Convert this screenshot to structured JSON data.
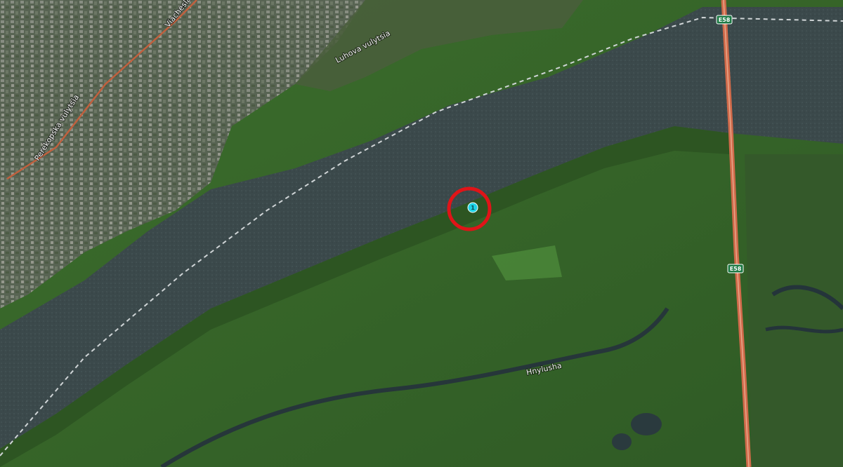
{
  "map": {
    "view": "satellite",
    "labels": {
      "street_1": "Viacheslava",
      "street_2": "Luhova vulytsia",
      "street_3": "Perekopska vulytsia",
      "river": "Hnylusha"
    },
    "highway": {
      "shield_label": "E58",
      "shield_label_2": "E58"
    },
    "marker": {
      "label": "1",
      "pin_color": "#1fd3e6",
      "ring_color": "#e01418"
    },
    "colors": {
      "water": "#3d4b4d",
      "vegetation": "#3f6e2f",
      "highway": "#d06a4a",
      "boundary": "#cfd4d6"
    }
  }
}
